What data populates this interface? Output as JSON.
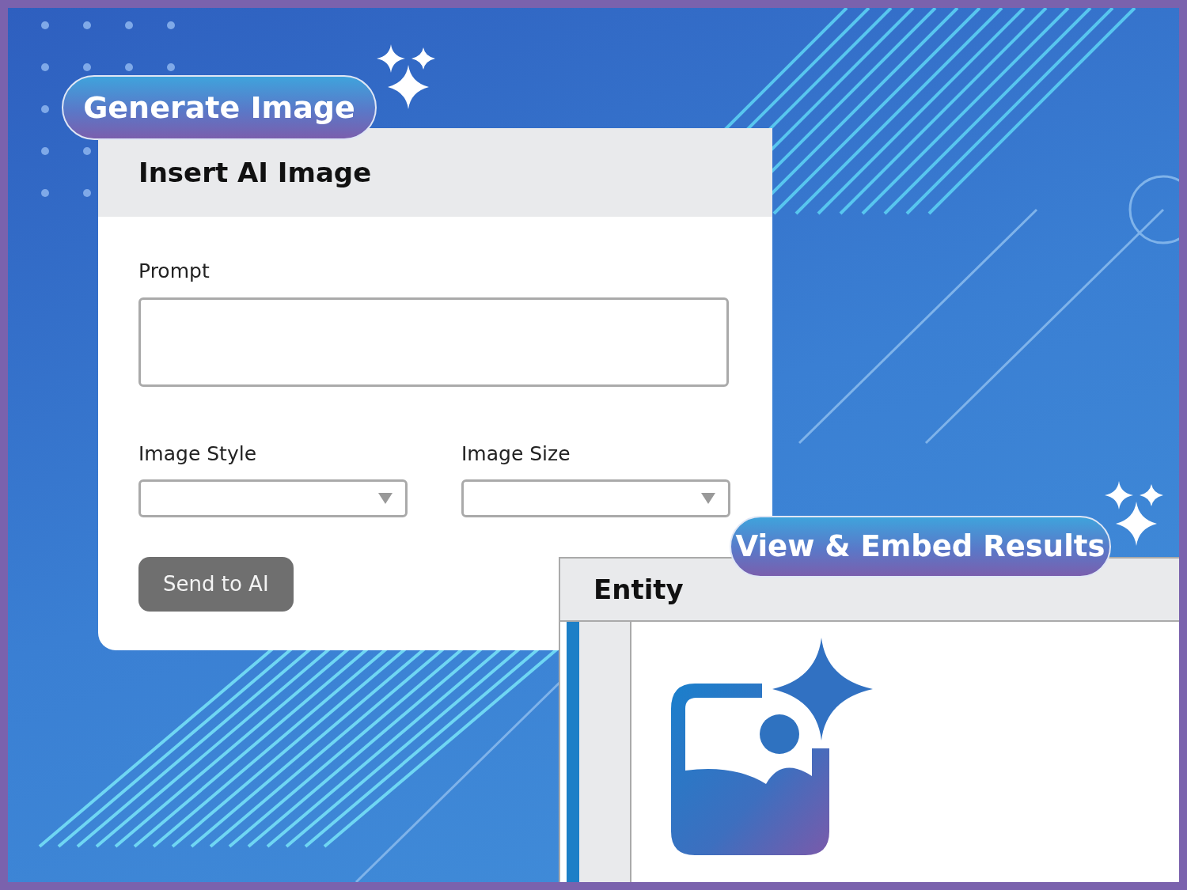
{
  "badges": [
    {
      "label": "Generate Image"
    },
    {
      "label": "View & Embed Results"
    }
  ],
  "form_card": {
    "title": "Insert AI Image",
    "fields": [
      {
        "label": "Prompt",
        "kind": "textarea"
      },
      {
        "label": "Image Style",
        "kind": "select"
      },
      {
        "label": "Image Size",
        "kind": "select"
      }
    ],
    "button": {
      "label": "Send to AI"
    }
  },
  "entity_panel": {
    "title": "Entity"
  }
}
